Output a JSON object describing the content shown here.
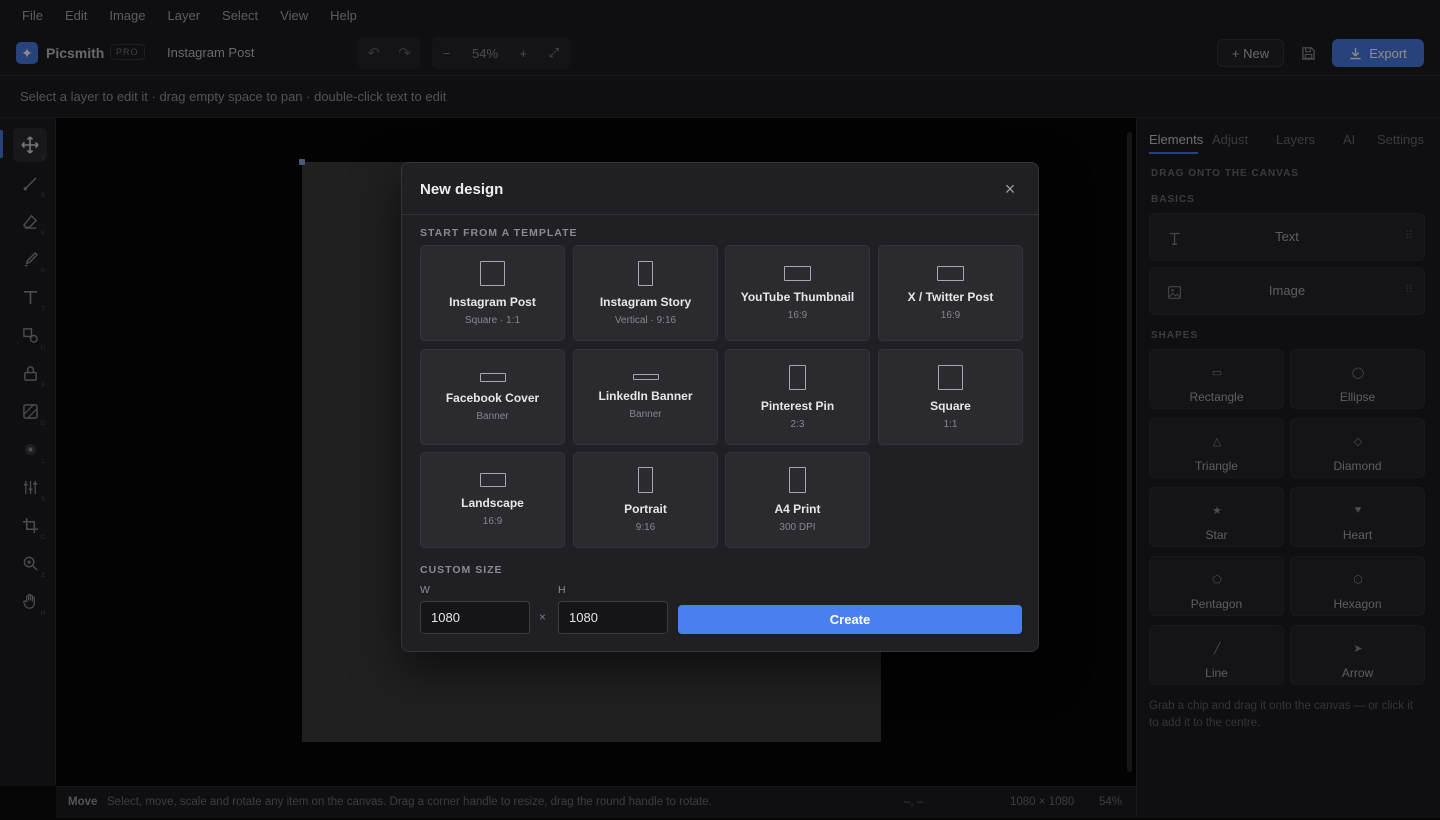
{
  "menu": [
    "File",
    "Edit",
    "Image",
    "Layer",
    "Select",
    "View",
    "Help"
  ],
  "app": {
    "name": "Picsmith",
    "badge": "PRO",
    "document": "Instagram Post"
  },
  "toolbar": {
    "undo": "↶",
    "redo": "↷",
    "zoom_out": "−",
    "zoom": "54%",
    "zoom_in": "+",
    "fit": "⤢",
    "new_label": "+ New",
    "export_label": "Export"
  },
  "hint": "Select a layer to edit it · drag empty space to pan · double-click text to edit",
  "tools": [
    {
      "name": "move",
      "key": "V",
      "active": true
    },
    {
      "name": "brush",
      "key": "B"
    },
    {
      "name": "eraser",
      "key": "E"
    },
    {
      "name": "pen",
      "key": "P"
    },
    {
      "name": "text",
      "key": "T"
    },
    {
      "name": "shapes",
      "key": "U"
    },
    {
      "name": "lock",
      "key": "F"
    },
    {
      "name": "pattern",
      "key": "G"
    },
    {
      "name": "blur",
      "key": "L"
    },
    {
      "name": "adjust",
      "key": "S"
    },
    {
      "name": "crop",
      "key": "C"
    },
    {
      "name": "zoom",
      "key": "Z"
    },
    {
      "name": "hand",
      "key": "H"
    }
  ],
  "right_panel": {
    "tabs": [
      "Elements",
      "Adjust",
      "Layers",
      "AI",
      "Settings"
    ],
    "active_tab": "Elements",
    "drag_heading": "DRAG ONTO THE CANVAS",
    "basics_heading": "BASICS",
    "basics": [
      {
        "label": "Text",
        "icon": "text-icon"
      },
      {
        "label": "Image",
        "icon": "image-icon"
      }
    ],
    "shapes_heading": "SHAPES",
    "shapes": [
      {
        "label": "Rectangle",
        "glyph": "▭"
      },
      {
        "label": "Ellipse",
        "glyph": "◯"
      },
      {
        "label": "Triangle",
        "glyph": "△"
      },
      {
        "label": "Diamond",
        "glyph": "◇"
      },
      {
        "label": "Star",
        "glyph": "★"
      },
      {
        "label": "Heart",
        "glyph": "♥"
      },
      {
        "label": "Pentagon",
        "glyph": "⬠"
      },
      {
        "label": "Hexagon",
        "glyph": "⬡"
      },
      {
        "label": "Line",
        "glyph": "╱"
      },
      {
        "label": "Arrow",
        "glyph": "➤"
      }
    ],
    "footer": "Grab a chip and drag it onto the canvas — or click it to add it to the centre."
  },
  "status": {
    "mode": "Move",
    "hint": "Select, move, scale and rotate any item on the canvas. Drag a corner handle to resize, drag the round handle to rotate.",
    "coords": "–, –",
    "size": "1080 × 1080",
    "zoom": "54%"
  },
  "modal": {
    "title": "New design",
    "close": "×",
    "templates_heading": "START FROM A TEMPLATE",
    "templates": [
      {
        "name": "Instagram Post",
        "meta": "Square · 1:1",
        "ratio": [
          1,
          1
        ]
      },
      {
        "name": "Instagram Story",
        "meta": "Vertical · 9:16",
        "ratio": [
          9,
          16
        ]
      },
      {
        "name": "YouTube Thumbnail",
        "meta": "16:9",
        "ratio": [
          16,
          9
        ]
      },
      {
        "name": "X / Twitter Post",
        "meta": "16:9",
        "ratio": [
          16,
          9
        ]
      },
      {
        "name": "Facebook Cover",
        "meta": "Banner",
        "ratio": [
          2.7,
          1
        ]
      },
      {
        "name": "LinkedIn Banner",
        "meta": "Banner",
        "ratio": [
          4,
          1
        ]
      },
      {
        "name": "Pinterest Pin",
        "meta": "2:3",
        "ratio": [
          2,
          3
        ]
      },
      {
        "name": "Square",
        "meta": "1:1",
        "ratio": [
          1,
          1
        ]
      },
      {
        "name": "Landscape",
        "meta": "16:9",
        "ratio": [
          16,
          9
        ]
      },
      {
        "name": "Portrait",
        "meta": "9:16",
        "ratio": [
          9,
          16
        ]
      },
      {
        "name": "A4 Print",
        "meta": "300 DPI",
        "ratio": [
          1,
          1.414
        ]
      }
    ],
    "custom_heading": "CUSTOM SIZE",
    "width_label": "W",
    "height_label": "H",
    "width": "1080",
    "height": "1080",
    "times": "×",
    "create_label": "Create"
  }
}
